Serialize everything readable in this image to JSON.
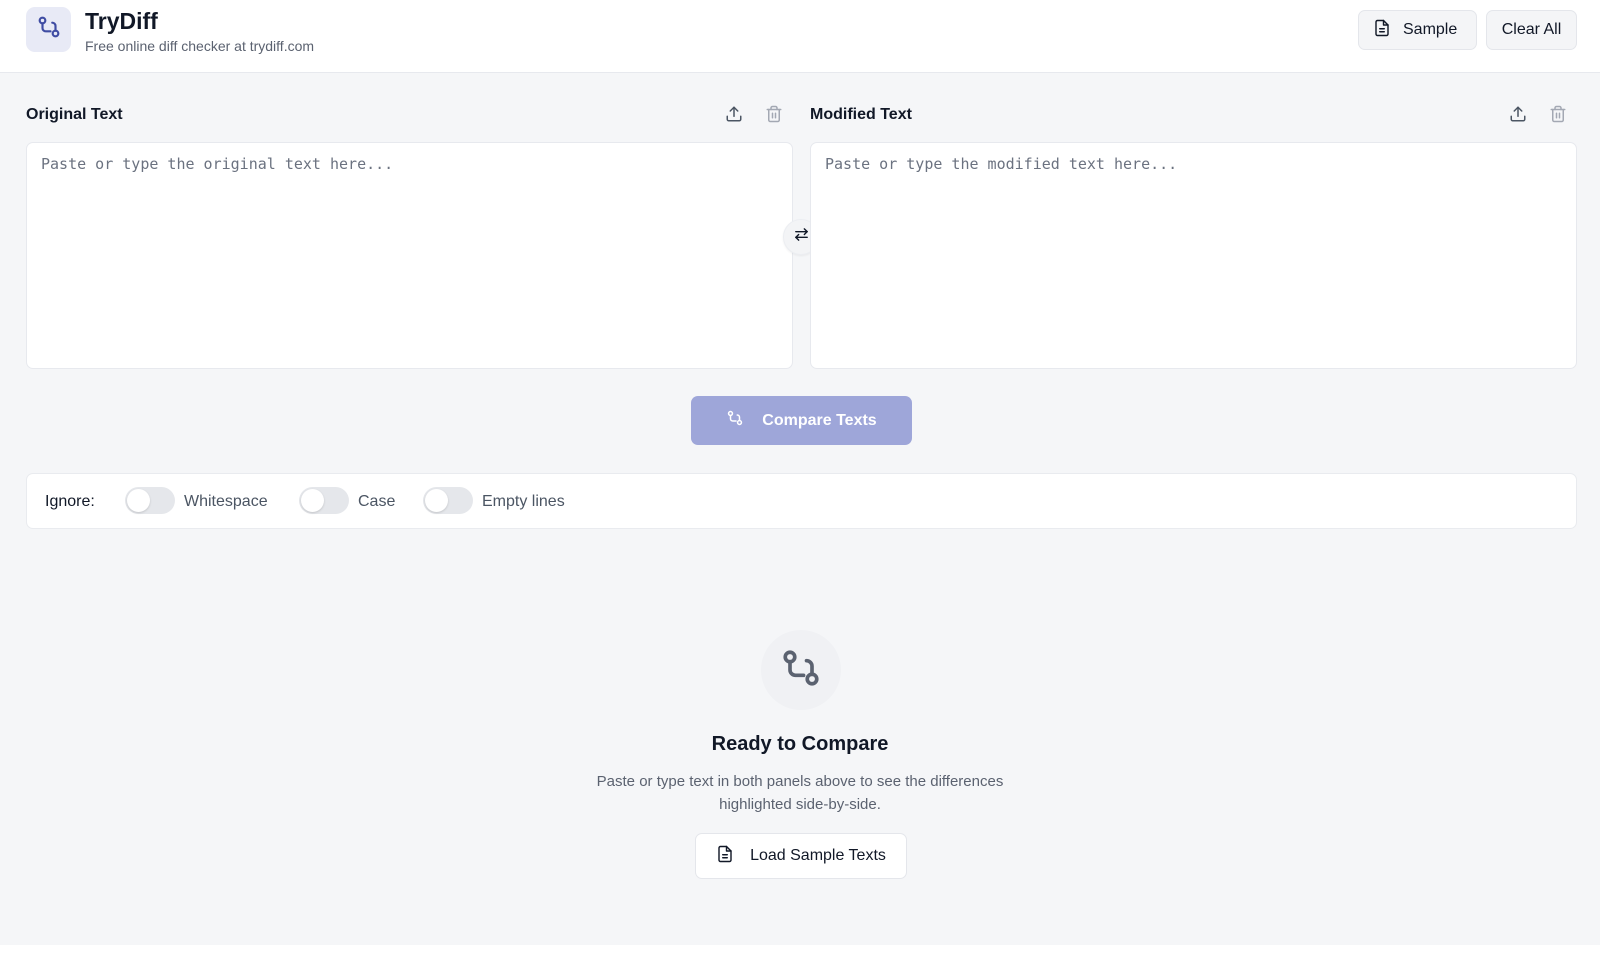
{
  "app": {
    "title": "TryDiff",
    "subtitle": "Free online diff checker at trydiff.com",
    "logo_icon": "git-compare-icon"
  },
  "header": {
    "sample_label": "Sample",
    "sample_icon": "file-text-icon",
    "clear_label": "Clear All"
  },
  "panels": {
    "original": {
      "label": "Original Text",
      "placeholder": "Paste or type the original text here...",
      "value": "",
      "upload_icon": "upload-icon",
      "delete_icon": "trash-icon"
    },
    "modified": {
      "label": "Modified Text",
      "placeholder": "Paste or type the modified text here...",
      "value": "",
      "upload_icon": "upload-icon",
      "delete_icon": "trash-icon"
    },
    "swap_icon": "swap-arrows-icon"
  },
  "compare": {
    "label": "Compare Texts",
    "icon": "git-compare-icon"
  },
  "options": {
    "ignore_label": "Ignore:",
    "toggles": [
      {
        "label": "Whitespace",
        "on": false
      },
      {
        "label": "Case",
        "on": false
      },
      {
        "label": "Empty lines",
        "on": false
      }
    ]
  },
  "empty_state": {
    "icon": "git-compare-icon",
    "title": "Ready to Compare",
    "description": "Paste or type text in both panels above to see the differences highlighted side-by-side.",
    "load_label": "Load Sample Texts",
    "load_icon": "file-text-icon"
  },
  "colors": {
    "accent": "#3f4ca3",
    "compare_button": "#9ea6d9",
    "logo_bg": "#e8eaf6",
    "page_bg": "#f5f6f8"
  }
}
